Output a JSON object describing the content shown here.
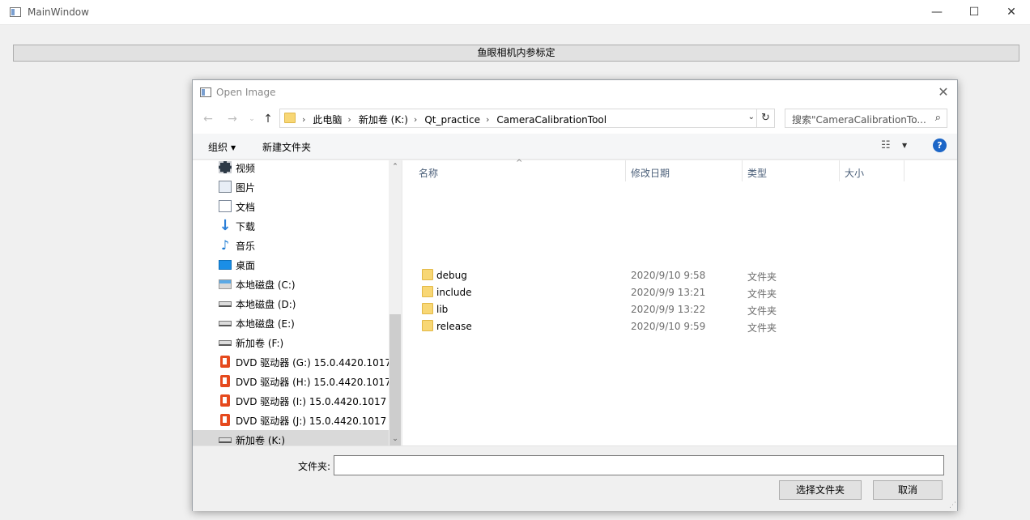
{
  "main_window": {
    "title": "MainWindow",
    "calibrate_button_label": "鱼眼相机内参标定",
    "controls": {
      "minimize": "—",
      "maximize": "☐",
      "close": "✕"
    }
  },
  "dialog": {
    "title": "Open Image",
    "close_glyph": "✕",
    "nav": {
      "back": "←",
      "forward": "→",
      "recent": "⌄",
      "up": "↑"
    },
    "address": {
      "crumbs": [
        "此电脑",
        "新加卷 (K:)",
        "Qt_practice",
        "CameraCalibrationTool"
      ],
      "separator": "›",
      "dropdown": "⌄",
      "refresh": "↻"
    },
    "search": {
      "placeholder": "搜索\"CameraCalibrationTo...",
      "icon": "⌕"
    },
    "toolbar": {
      "organize": "组织",
      "new_folder": "新建文件夹",
      "view_glyph": "☷",
      "help_glyph": "?"
    },
    "tree": [
      {
        "label": "视频",
        "icon": "video-icon"
      },
      {
        "label": "图片",
        "icon": "image-icon"
      },
      {
        "label": "文档",
        "icon": "document-icon"
      },
      {
        "label": "下载",
        "icon": "download-icon"
      },
      {
        "label": "音乐",
        "icon": "music-icon"
      },
      {
        "label": "桌面",
        "icon": "desktop-icon"
      },
      {
        "label": "本地磁盘 (C:)",
        "icon": "system-drive-icon"
      },
      {
        "label": "本地磁盘 (D:)",
        "icon": "drive-icon"
      },
      {
        "label": "本地磁盘 (E:)",
        "icon": "drive-icon"
      },
      {
        "label": "新加卷 (F:)",
        "icon": "drive-icon"
      },
      {
        "label": "DVD 驱动器 (G:) 15.0.4420.1017",
        "icon": "office-icon"
      },
      {
        "label": "DVD 驱动器 (H:) 15.0.4420.1017",
        "icon": "office-icon"
      },
      {
        "label": "DVD 驱动器 (I:) 15.0.4420.1017",
        "icon": "office-icon"
      },
      {
        "label": "DVD 驱动器 (J:) 15.0.4420.1017",
        "icon": "office-icon"
      },
      {
        "label": "新加卷 (K:)",
        "icon": "drive-icon",
        "selected": true
      }
    ],
    "scrollbar": {
      "up": "⌃",
      "down": "⌄"
    },
    "columns": {
      "name": "名称",
      "modified": "修改日期",
      "type": "类型",
      "size": "大小",
      "sort_glyph": "^"
    },
    "files": [
      {
        "name": "debug",
        "modified": "2020/9/10 9:58",
        "type": "文件夹"
      },
      {
        "name": "include",
        "modified": "2020/9/9 13:21",
        "type": "文件夹"
      },
      {
        "name": "lib",
        "modified": "2020/9/9 13:22",
        "type": "文件夹"
      },
      {
        "name": "release",
        "modified": "2020/9/10 9:59",
        "type": "文件夹"
      }
    ],
    "footer": {
      "folder_label": "文件夹:",
      "folder_value": "",
      "select_button": "选择文件夹",
      "cancel_button": "取消"
    }
  },
  "colors": {
    "folder": "#f8d775",
    "help": "#1c66c7",
    "selected_row": "#d9d9d9",
    "office": "#e5491d"
  }
}
